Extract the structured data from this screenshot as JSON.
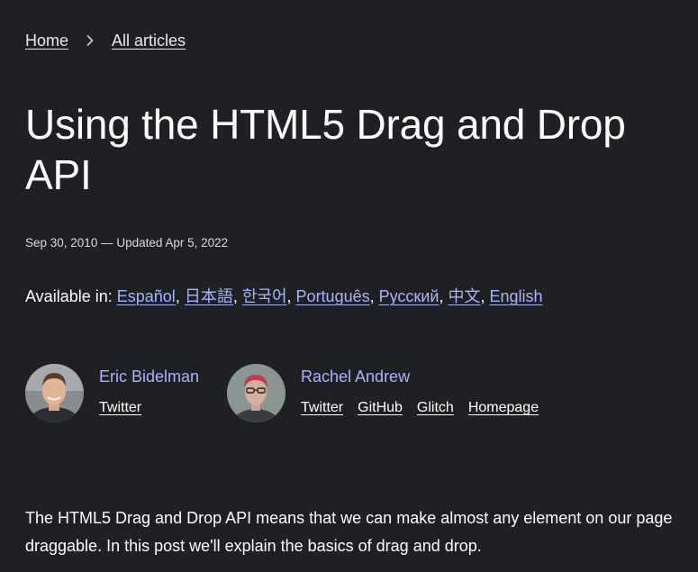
{
  "breadcrumb": {
    "home_label": "Home",
    "separator_icon": "chevron-right-icon",
    "articles_label": "All articles"
  },
  "article": {
    "title": "Using the HTML5 Drag and Drop API",
    "dates": "Sep 30, 2010 — Updated Apr 5, 2022",
    "available_in_label": "Available in:",
    "languages": [
      "Español",
      "日本語",
      "한국어",
      "Português",
      "Русский",
      "中文",
      "English"
    ],
    "intro": "The HTML5 Drag and Drop API means that we can make almost any element on our page draggable. In this post we'll explain the basics of drag and drop."
  },
  "authors": [
    {
      "name": "Eric Bidelman",
      "links": [
        "Twitter"
      ]
    },
    {
      "name": "Rachel Andrew",
      "links": [
        "Twitter",
        "GitHub",
        "Glitch",
        "Homepage"
      ]
    }
  ],
  "colors": {
    "background": "#1f2023",
    "link_accent": "#a8b4ff",
    "text": "#ffffff"
  }
}
